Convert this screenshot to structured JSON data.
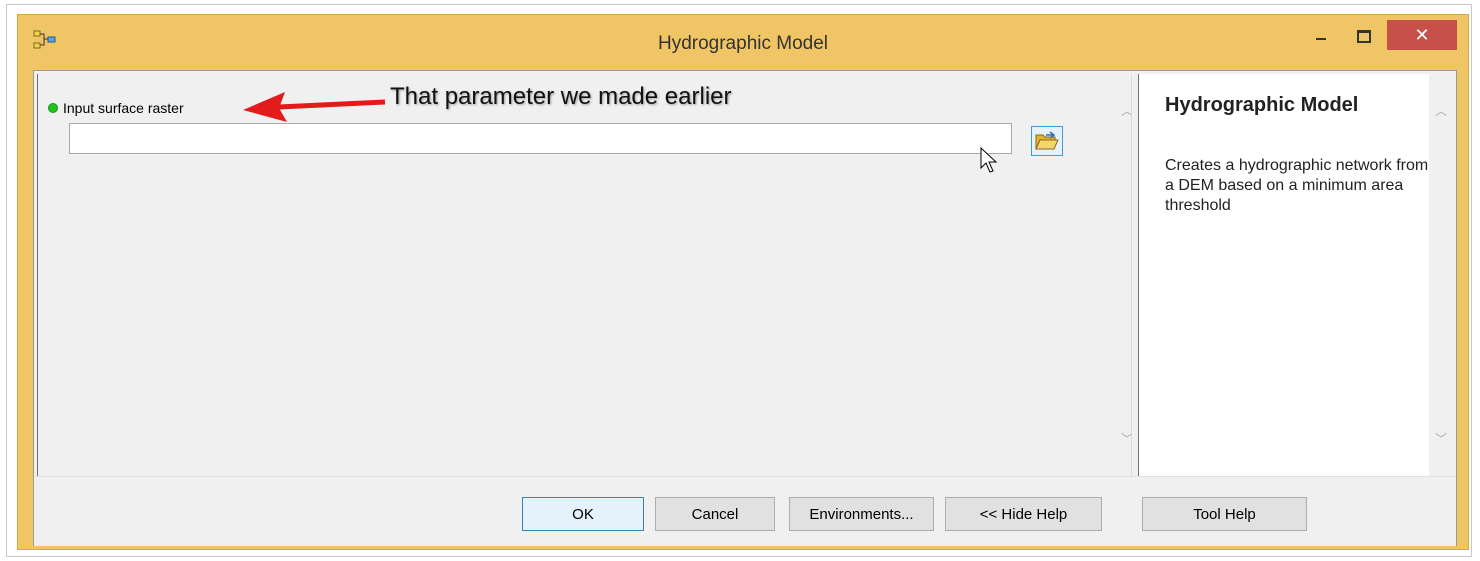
{
  "window": {
    "title": "Hydrographic Model",
    "controls": {
      "minimize_icon": "minimize-icon",
      "maximize_icon": "maximize-icon",
      "close_label": "✕"
    }
  },
  "parameters": [
    {
      "label": "Input surface raster",
      "required": true,
      "value": ""
    }
  ],
  "annotation": {
    "text": "That parameter we made earlier"
  },
  "help": {
    "title": "Hydrographic Model",
    "description": "Creates a hydrographic network from a DEM based on a minimum area threshold"
  },
  "buttons": {
    "ok": "OK",
    "cancel": "Cancel",
    "environments": "Environments...",
    "hide_help": "<< Hide Help",
    "tool_help": "Tool Help"
  },
  "colors": {
    "window_frame": "#f0c566",
    "close_button": "#c7514a",
    "required_dot": "#1fc51f",
    "annotation_arrow": "#e31b1b"
  }
}
